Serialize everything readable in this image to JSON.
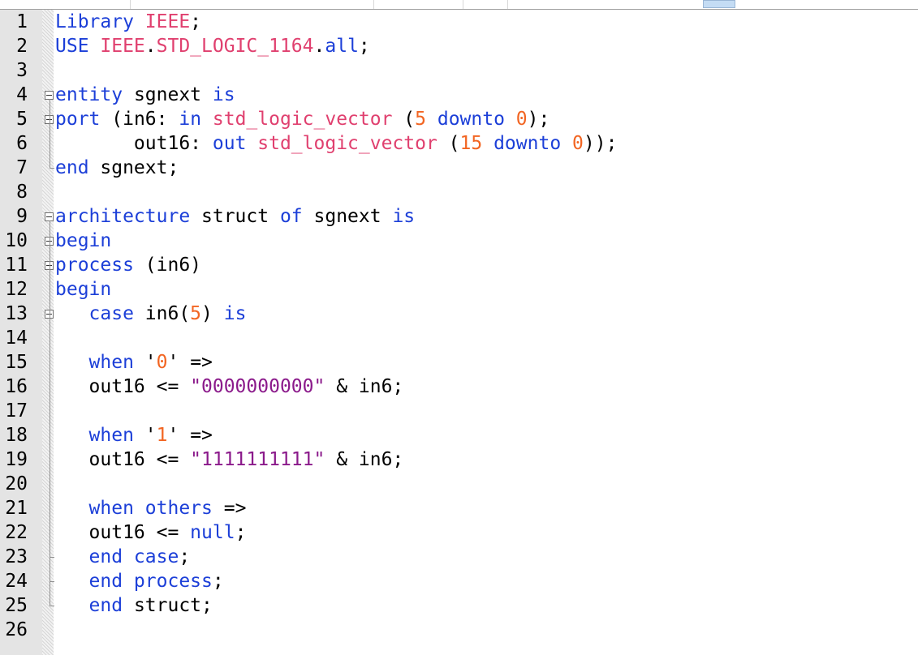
{
  "lines": [
    {
      "n": "1",
      "tokens": [
        {
          "t": "Library ",
          "c": "kw"
        },
        {
          "t": "IEEE",
          "c": "ty"
        },
        {
          "t": ";",
          "c": "p"
        }
      ]
    },
    {
      "n": "2",
      "tokens": [
        {
          "t": "USE ",
          "c": "kw"
        },
        {
          "t": "IEEE",
          "c": "ty"
        },
        {
          "t": ".",
          "c": "p"
        },
        {
          "t": "STD_LOGIC_1164",
          "c": "ty"
        },
        {
          "t": ".",
          "c": "p"
        },
        {
          "t": "all",
          "c": "kw"
        },
        {
          "t": ";",
          "c": "p"
        }
      ]
    },
    {
      "n": "3",
      "tokens": []
    },
    {
      "n": "4",
      "fold": true,
      "tokens": [
        {
          "t": "entity ",
          "c": "kw"
        },
        {
          "t": "sgnext ",
          "c": "p"
        },
        {
          "t": "is",
          "c": "kw"
        }
      ]
    },
    {
      "n": "5",
      "fold": true,
      "tokens": [
        {
          "t": "port ",
          "c": "kw"
        },
        {
          "t": "(in6: ",
          "c": "p"
        },
        {
          "t": "in ",
          "c": "kw"
        },
        {
          "t": "std_logic_vector ",
          "c": "ty"
        },
        {
          "t": "(",
          "c": "p"
        },
        {
          "t": "5 ",
          "c": "num"
        },
        {
          "t": "downto ",
          "c": "kw"
        },
        {
          "t": "0",
          "c": "num"
        },
        {
          "t": ");",
          "c": "p"
        }
      ]
    },
    {
      "n": "6",
      "tokens": [
        {
          "t": "       out16: ",
          "c": "p"
        },
        {
          "t": "out ",
          "c": "kw"
        },
        {
          "t": "std_logic_vector ",
          "c": "ty"
        },
        {
          "t": "(",
          "c": "p"
        },
        {
          "t": "15 ",
          "c": "num"
        },
        {
          "t": "downto ",
          "c": "kw"
        },
        {
          "t": "0",
          "c": "num"
        },
        {
          "t": "));",
          "c": "p"
        }
      ]
    },
    {
      "n": "7",
      "tokens": [
        {
          "t": "end ",
          "c": "kw"
        },
        {
          "t": "sgnext;",
          "c": "p"
        }
      ]
    },
    {
      "n": "8",
      "tokens": []
    },
    {
      "n": "9",
      "fold": true,
      "tokens": [
        {
          "t": "architecture ",
          "c": "kw"
        },
        {
          "t": "struct ",
          "c": "p"
        },
        {
          "t": "of ",
          "c": "kw"
        },
        {
          "t": "sgnext ",
          "c": "p"
        },
        {
          "t": "is",
          "c": "kw"
        }
      ]
    },
    {
      "n": "10",
      "fold": true,
      "tokens": [
        {
          "t": "begin",
          "c": "kw"
        }
      ]
    },
    {
      "n": "11",
      "fold": true,
      "tokens": [
        {
          "t": "process ",
          "c": "kw"
        },
        {
          "t": "(in6)",
          "c": "p"
        }
      ]
    },
    {
      "n": "12",
      "tokens": [
        {
          "t": "begin",
          "c": "kw"
        }
      ]
    },
    {
      "n": "13",
      "fold": true,
      "tokens": [
        {
          "t": "   case ",
          "c": "kw"
        },
        {
          "t": "in6(",
          "c": "p"
        },
        {
          "t": "5",
          "c": "num"
        },
        {
          "t": ") ",
          "c": "p"
        },
        {
          "t": "is",
          "c": "kw"
        }
      ]
    },
    {
      "n": "14",
      "tokens": []
    },
    {
      "n": "15",
      "tokens": [
        {
          "t": "   when ",
          "c": "kw"
        },
        {
          "t": "'",
          "c": "p"
        },
        {
          "t": "0",
          "c": "num"
        },
        {
          "t": "' =>",
          "c": "p"
        }
      ]
    },
    {
      "n": "16",
      "tokens": [
        {
          "t": "   out16 <= ",
          "c": "p"
        },
        {
          "t": "\"0000000000\"",
          "c": "str"
        },
        {
          "t": " & in6;",
          "c": "p"
        }
      ]
    },
    {
      "n": "17",
      "tokens": []
    },
    {
      "n": "18",
      "tokens": [
        {
          "t": "   when ",
          "c": "kw"
        },
        {
          "t": "'",
          "c": "p"
        },
        {
          "t": "1",
          "c": "num"
        },
        {
          "t": "' =>",
          "c": "p"
        }
      ]
    },
    {
      "n": "19",
      "tokens": [
        {
          "t": "   out16 <= ",
          "c": "p"
        },
        {
          "t": "\"1111111111\"",
          "c": "str"
        },
        {
          "t": " & in6;",
          "c": "p"
        }
      ]
    },
    {
      "n": "20",
      "tokens": []
    },
    {
      "n": "21",
      "tokens": [
        {
          "t": "   when others ",
          "c": "kw"
        },
        {
          "t": "=>",
          "c": "p"
        }
      ]
    },
    {
      "n": "22",
      "tokens": [
        {
          "t": "   out16 <= ",
          "c": "p"
        },
        {
          "t": "null",
          "c": "kw"
        },
        {
          "t": ";",
          "c": "p"
        }
      ]
    },
    {
      "n": "23",
      "tokens": [
        {
          "t": "   end case",
          "c": "kw"
        },
        {
          "t": ";",
          "c": "p"
        }
      ]
    },
    {
      "n": "24",
      "tokens": [
        {
          "t": "   end process",
          "c": "kw"
        },
        {
          "t": ";",
          "c": "p"
        }
      ]
    },
    {
      "n": "25",
      "tokens": [
        {
          "t": "   end ",
          "c": "kw"
        },
        {
          "t": "struct;",
          "c": "p"
        }
      ]
    },
    {
      "n": "26",
      "tokens": []
    }
  ]
}
